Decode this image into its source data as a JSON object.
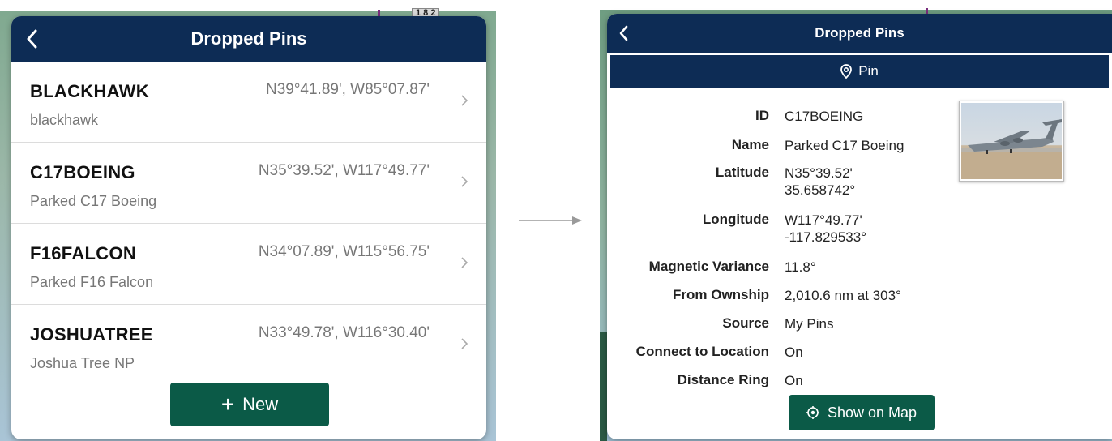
{
  "left_panel": {
    "title": "Dropped Pins",
    "pins": [
      {
        "id": "BLACKHAWK",
        "name": "blackhawk",
        "coords": "N39°41.89', W85°07.87'"
      },
      {
        "id": "C17BOEING",
        "name": "Parked C17 Boeing",
        "coords": "N35°39.52', W117°49.77'"
      },
      {
        "id": "F16FALCON",
        "name": "Parked F16 Falcon",
        "coords": "N34°07.89', W115°56.75'"
      },
      {
        "id": "JOSHUATREE",
        "name": "Joshua Tree NP",
        "coords": "N33°49.78', W116°30.40'"
      }
    ],
    "new_button": {
      "icon": "plus-icon",
      "label": "New"
    }
  },
  "right_panel": {
    "title": "Dropped Pins",
    "subheader": {
      "icon": "map-pin-icon",
      "label": "Pin"
    },
    "fields": [
      {
        "label": "ID",
        "lines": [
          "C17BOEING"
        ]
      },
      {
        "label": "Name",
        "lines": [
          "Parked C17 Boeing"
        ]
      },
      {
        "label": "Latitude",
        "lines": [
          "N35°39.52'",
          "35.658742°"
        ]
      },
      {
        "label": "Longitude",
        "lines": [
          "W117°49.77'",
          "-117.829533°"
        ]
      },
      {
        "label": "Magnetic Variance",
        "lines": [
          "11.8°"
        ]
      },
      {
        "label": "From Ownship",
        "lines": [
          "2,010.6 nm at 303°"
        ]
      },
      {
        "label": "Source",
        "lines": [
          "My Pins"
        ]
      },
      {
        "label": "Connect to Location",
        "lines": [
          "On"
        ]
      },
      {
        "label": "Distance Ring",
        "lines": [
          "On"
        ]
      }
    ],
    "show_button": {
      "icon": "target-icon",
      "label": "Show on Map"
    }
  },
  "map_chip_text": "1 8 2",
  "colors": {
    "header_navy": "#0d2c55",
    "button_green": "#0b5a47"
  }
}
